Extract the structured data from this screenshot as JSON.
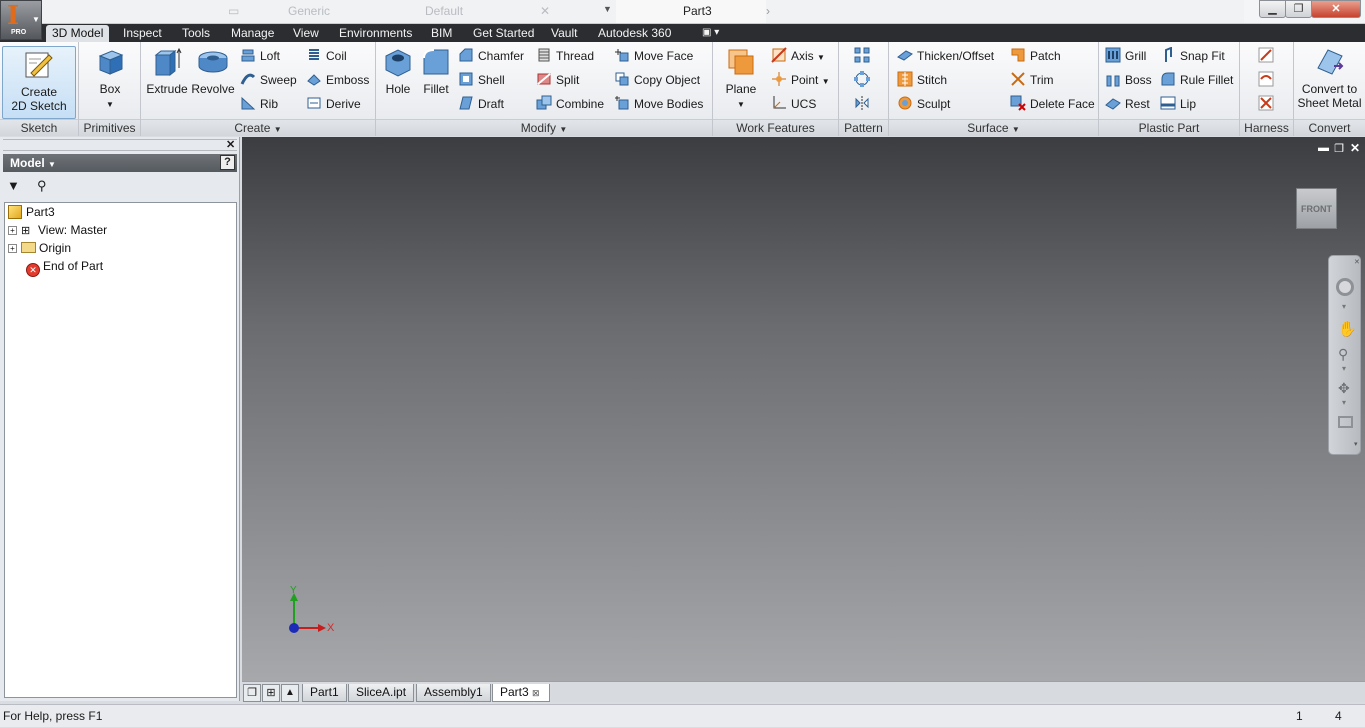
{
  "app": {
    "badge": "PRO",
    "document_title": "Part3"
  },
  "quick_access": {
    "material": "Generic",
    "appearance": "Default"
  },
  "tabs": [
    "3D Model",
    "Inspect",
    "Tools",
    "Manage",
    "View",
    "Environments",
    "BIM",
    "Get Started",
    "Vault",
    "Autodesk 360"
  ],
  "panels": {
    "sketch": {
      "label": "Sketch",
      "create_2d_sketch": "Create\n2D Sketch"
    },
    "primitives": {
      "label": "Primitives",
      "box": "Box"
    },
    "create": {
      "label": "Create",
      "extrude": "Extrude",
      "revolve": "Revolve",
      "loft": "Loft",
      "coil": "Coil",
      "sweep": "Sweep",
      "emboss": "Emboss",
      "rib": "Rib",
      "derive": "Derive"
    },
    "modify": {
      "label": "Modify",
      "hole": "Hole",
      "fillet": "Fillet",
      "chamfer": "Chamfer",
      "thread": "Thread",
      "move_face": "Move Face",
      "shell": "Shell",
      "split": "Split",
      "copy_object": "Copy Object",
      "draft": "Draft",
      "combine": "Combine",
      "move_bodies": "Move Bodies"
    },
    "work_features": {
      "label": "Work Features",
      "plane": "Plane",
      "axis": "Axis",
      "point": "Point",
      "ucs": "UCS"
    },
    "pattern": {
      "label": "Pattern"
    },
    "surface": {
      "label": "Surface",
      "thicken_offset": "Thicken/Offset",
      "patch": "Patch",
      "stitch": "Stitch",
      "trim": "Trim",
      "sculpt": "Sculpt",
      "delete_face": "Delete Face"
    },
    "plastic_part": {
      "label": "Plastic Part",
      "grill": "Grill",
      "snap_fit": "Snap Fit",
      "boss": "Boss",
      "rule_fillet": "Rule Fillet",
      "rest": "Rest",
      "lip": "Lip"
    },
    "harness": {
      "label": "Harness"
    },
    "convert": {
      "label": "Convert",
      "convert_to_sheet_metal": "Convert to\nSheet Metal"
    }
  },
  "browser": {
    "title": "Model",
    "tree": [
      {
        "label": "Part3"
      },
      {
        "label": "View: Master"
      },
      {
        "label": "Origin"
      },
      {
        "label": "End of Part"
      }
    ]
  },
  "viewport": {
    "viewcube_face": "FRONT",
    "axis_x": "X",
    "axis_y": "Y"
  },
  "document_tabs": [
    "Part1",
    "SliceA.ipt",
    "Assembly1",
    "Part3"
  ],
  "status": {
    "help": "For Help, press F1",
    "count_a": "1",
    "count_b": "4"
  },
  "colors": {
    "accent_orange": "#e06b1a",
    "viewport_top": "#3b3d41",
    "viewport_bottom": "#a6a8ab",
    "ribbon_tabbar": "#2b2d30"
  }
}
